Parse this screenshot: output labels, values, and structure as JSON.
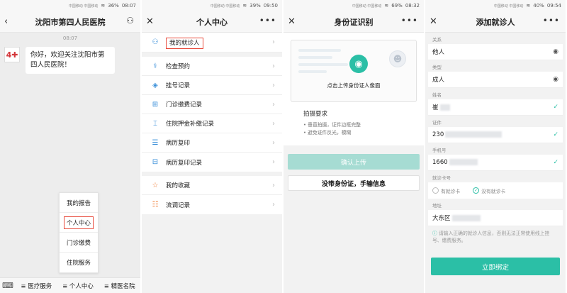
{
  "panel1": {
    "status": {
      "signal": "中国移动 中国移动",
      "battery": "36%",
      "time": "08:07"
    },
    "title": "沈阳市第四人民医院",
    "chat_time": "08:07",
    "message": "你好，欢迎关注沈阳市第四人民医院！",
    "menu": [
      "我的报告",
      "个人中心",
      "门诊缴费",
      "住院服务"
    ],
    "bottom_tabs": [
      "≡ 医疗服务",
      "≡ 个人中心",
      "≡ 精医名院"
    ]
  },
  "panel2": {
    "status": {
      "signal": "中国移动 中国移动",
      "battery": "39%",
      "time": "09:50"
    },
    "title": "个人中心",
    "group1": [
      "我的就诊人"
    ],
    "group2": [
      "检查预约",
      "挂号记录",
      "门诊缴费记录",
      "住院押金补缴记录",
      "病历复印",
      "病历复印记录"
    ],
    "group3": [
      "我的收藏",
      "流调记录"
    ]
  },
  "panel3": {
    "status": {
      "signal": "中国移动 中国移动",
      "battery": "69%",
      "time": "08:32"
    },
    "title": "身份证识别",
    "upload_caption": "点击上传身份证人像面",
    "req_title": "拍摄要求",
    "req_items": [
      "• 垂直拍摄，证件边框完整",
      "• 避免证件反光，模糊"
    ],
    "confirm_btn": "确认上传",
    "manual_btn": "没带身份证，手输信息"
  },
  "panel4": {
    "status": {
      "signal": "中国移动 中国移动",
      "battery": "40%",
      "time": "09:54"
    },
    "title": "添加就诊人",
    "labels": {
      "relation": "关系",
      "type": "类型",
      "name": "姓名",
      "id": "证件",
      "phone": "手机号",
      "card": "就诊卡号",
      "address": "地址"
    },
    "values": {
      "relation": "他人",
      "type": "成人",
      "name": "崔",
      "id": "230",
      "phone": "1660",
      "address": "大东区"
    },
    "radio1": "有就诊卡",
    "radio2": "没有就诊卡",
    "note": "请输入正确的就诊人信息，否则无法正常使用线上挂号、缴费服务。",
    "bind_btn": "立即绑定"
  }
}
